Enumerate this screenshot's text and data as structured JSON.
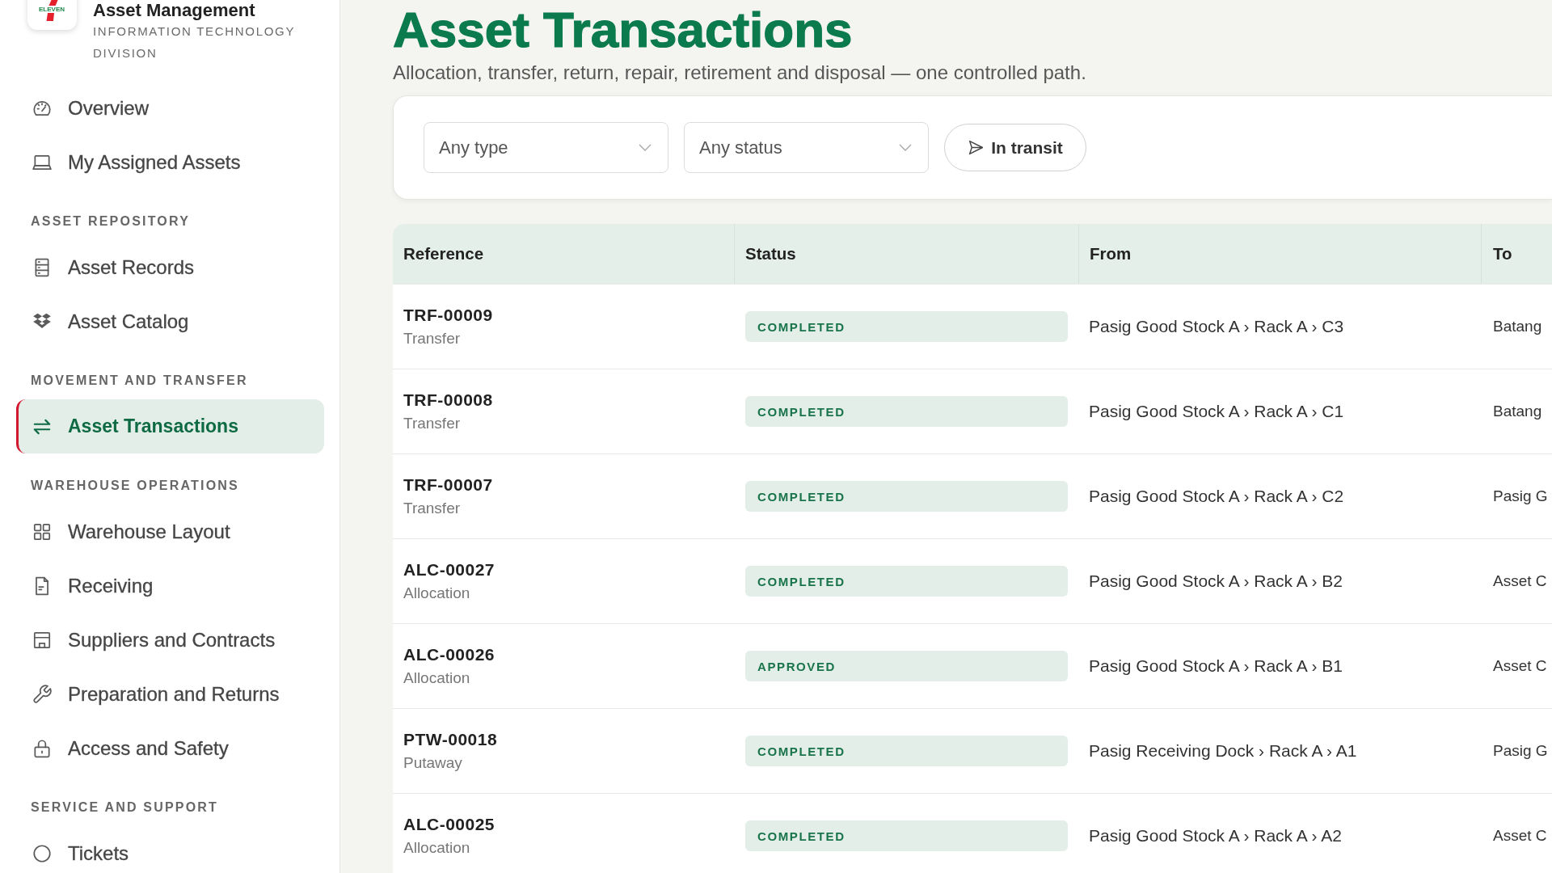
{
  "sidebar": {
    "brand": {
      "logo_text": "ELEVEN",
      "title": "Asset Management",
      "subtitle": "INFORMATION TECHNOLOGY DIVISION"
    },
    "sections": [
      {
        "items": [
          {
            "label": "Overview",
            "selected": false
          },
          {
            "label": "My Assigned Assets",
            "selected": false
          }
        ]
      },
      {
        "heading": "ASSET REPOSITORY",
        "items": [
          {
            "label": "Asset Records",
            "selected": false
          },
          {
            "label": "Asset Catalog",
            "selected": false
          }
        ]
      },
      {
        "heading": "MOVEMENT AND TRANSFER",
        "items": [
          {
            "label": "Asset Transactions",
            "selected": true
          }
        ]
      },
      {
        "heading": "WAREHOUSE OPERATIONS",
        "items": [
          {
            "label": "Warehouse Layout",
            "selected": false
          },
          {
            "label": "Receiving",
            "selected": false
          },
          {
            "label": "Suppliers and Contracts",
            "selected": false
          },
          {
            "label": "Preparation and Returns",
            "selected": false
          },
          {
            "label": "Access and Safety",
            "selected": false
          }
        ]
      },
      {
        "heading": "SERVICE AND SUPPORT",
        "items": [
          {
            "label": "Tickets",
            "selected": false
          }
        ]
      }
    ]
  },
  "page": {
    "title": "Asset Transactions",
    "subtitle": "Allocation, transfer, return, repair, retirement and disposal — one controlled path."
  },
  "filters": {
    "type_select": {
      "value": "Any type"
    },
    "status_select": {
      "value": "Any status"
    },
    "in_transit_button": {
      "label": "In transit"
    }
  },
  "table": {
    "columns": [
      "Reference",
      "Status",
      "From",
      "To"
    ],
    "rows": [
      {
        "reference": "TRF-00009",
        "type": "Transfer",
        "status": "COMPLETED",
        "from": "Pasig Good Stock A › Rack A › C3",
        "to": "Batang"
      },
      {
        "reference": "TRF-00008",
        "type": "Transfer",
        "status": "COMPLETED",
        "from": "Pasig Good Stock A › Rack A › C1",
        "to": "Batang"
      },
      {
        "reference": "TRF-00007",
        "type": "Transfer",
        "status": "COMPLETED",
        "from": "Pasig Good Stock A › Rack A › C2",
        "to": "Pasig G"
      },
      {
        "reference": "ALC-00027",
        "type": "Allocation",
        "status": "COMPLETED",
        "from": "Pasig Good Stock A › Rack A › B2",
        "to": "Asset C"
      },
      {
        "reference": "ALC-00026",
        "type": "Allocation",
        "status": "APPROVED",
        "from": "Pasig Good Stock A › Rack A › B1",
        "to": "Asset C"
      },
      {
        "reference": "PTW-00018",
        "type": "Putaway",
        "status": "COMPLETED",
        "from": "Pasig Receiving Dock › Rack A › A1",
        "to": "Pasig G"
      },
      {
        "reference": "ALC-00025",
        "type": "Allocation",
        "status": "COMPLETED",
        "from": "Pasig Good Stock A › Rack A › A2",
        "to": "Asset C"
      }
    ]
  }
}
